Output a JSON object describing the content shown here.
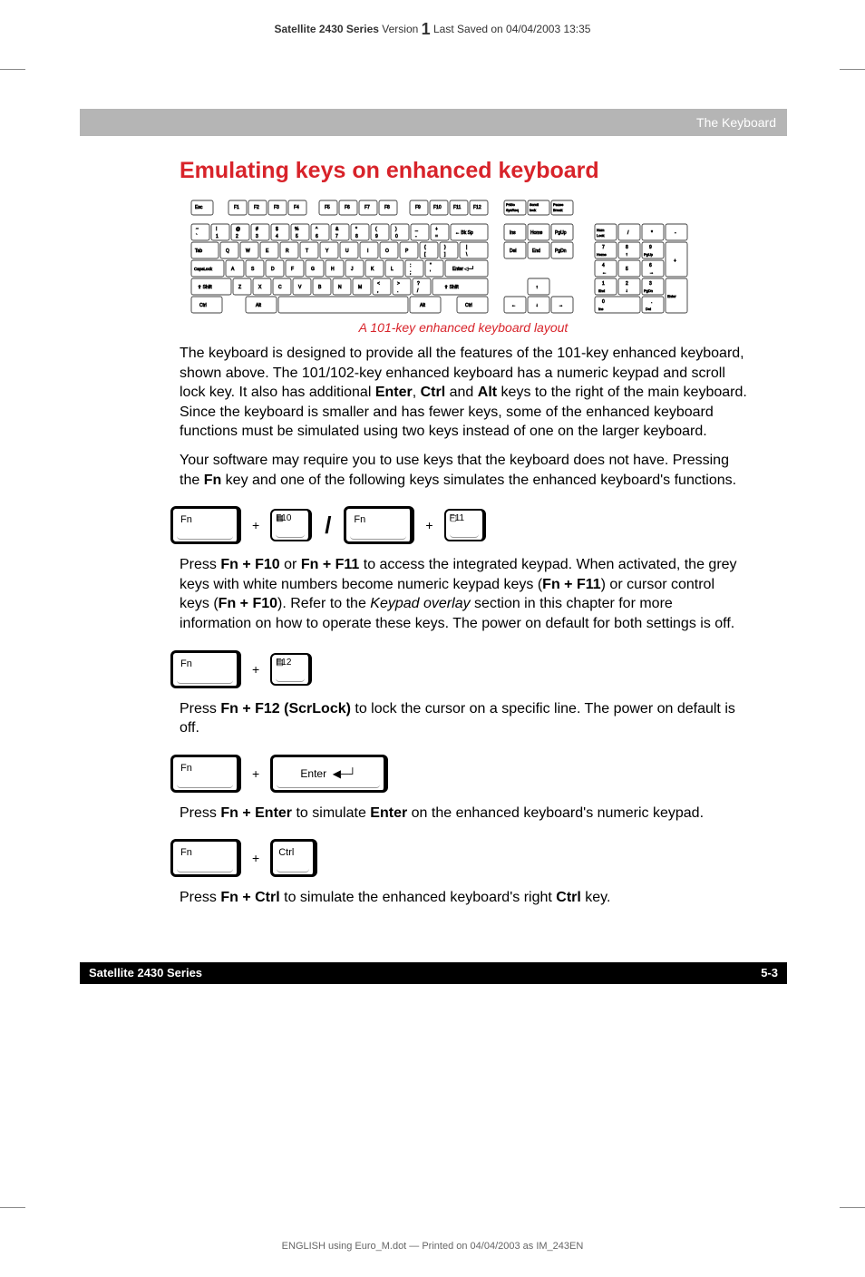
{
  "meta": {
    "product": "Satellite 2430 Series",
    "version_label": "Version",
    "version_num": "1",
    "saved": "Last Saved on 04/04/2003 13:35",
    "footer_print": "ENGLISH using Euro_M.dot — Printed on 04/04/2003 as IM_243EN"
  },
  "header": {
    "section": "The Keyboard"
  },
  "title": "Emulating keys on enhanced keyboard",
  "caption": "A 101-key enhanced keyboard layout",
  "paragraphs": {
    "p1_a": "The keyboard is designed to provide all the features of the 101-key enhanced keyboard, shown above. The 101/102-key enhanced keyboard has a numeric keypad and scroll lock key. It also has additional ",
    "p1_b": "Enter",
    "p1_c": ", ",
    "p1_d": "Ctrl",
    "p1_e": " and ",
    "p1_f": "Alt",
    "p1_g": " keys to the right of the main keyboard. Since the keyboard is smaller and has fewer keys, some of the enhanced keyboard functions must be simulated using two keys instead of one on the larger keyboard.",
    "p2_a": "Your software may require you to use keys that the keyboard does not have. Pressing the ",
    "p2_b": "Fn",
    "p2_c": " key and one of the following keys simulates the enhanced keyboard's functions.",
    "p3_a": "Press ",
    "p3_b": "Fn + F10",
    "p3_c": " or ",
    "p3_d": "Fn + F11",
    "p3_e": " to access the integrated keypad. When activated, the grey keys with white numbers become numeric keypad keys (",
    "p3_f": "Fn + F11",
    "p3_g": ") or cursor control keys (",
    "p3_h": "Fn + F10",
    "p3_i": "). Refer to the ",
    "p3_j": "Keypad overlay",
    "p3_k": " section in this chapter for more information on how to operate these keys. The power on default for both settings is off.",
    "p4_a": "Press ",
    "p4_b": "Fn + F12 (ScrLock)",
    "p4_c": " to lock the cursor on a specific line. The power on default is off.",
    "p5_a": "Press ",
    "p5_b": "Fn + Enter",
    "p5_c": " to simulate ",
    "p5_d": "Enter",
    "p5_e": " on the enhanced keyboard's numeric keypad.",
    "p6_a": "Press ",
    "p6_b": "Fn + Ctrl",
    "p6_c": " to simulate the enhanced keyboard's right ",
    "p6_d": "Ctrl",
    "p6_e": " key."
  },
  "keys": {
    "fn": "Fn",
    "f10": "F10",
    "f11": "F11",
    "f12": "F12",
    "enter": "Enter",
    "ctrl": "Ctrl",
    "plus": "+",
    "arrow": "◀─┘"
  },
  "keyboard_layout": {
    "row_func": [
      "Esc",
      "F1",
      "F2",
      "F3",
      "F4",
      "F5",
      "F6",
      "F7",
      "F8",
      "F9",
      "F10",
      "F11",
      "F12"
    ],
    "row_sys": [
      "PrtSc SysReq",
      "Scroll lock",
      "Pause Break"
    ],
    "row1_main": [
      "~ `",
      "! 1",
      "@ 2",
      "# 3",
      "$ 4",
      "% 5",
      "^ 6",
      "& 7",
      "* 8",
      "( 9",
      ") 0",
      "_ -",
      "+ =",
      "← Bk Sp"
    ],
    "row1_nav": [
      "Ins",
      "Home",
      "PgUp"
    ],
    "row2_main": [
      "Tab",
      "Q",
      "W",
      "E",
      "R",
      "T",
      "Y",
      "U",
      "I",
      "O",
      "P",
      "{ [",
      "} ]",
      "| \\"
    ],
    "row2_nav": [
      "Del",
      "End",
      "PgDn"
    ],
    "row3_main": [
      "CapsLock",
      "A",
      "S",
      "D",
      "F",
      "G",
      "H",
      "J",
      "K",
      "L",
      ": ;",
      "\" '",
      "Enter ◀─┘"
    ],
    "row4_main": [
      "⇧ Shift",
      "Z",
      "X",
      "C",
      "V",
      "B",
      "N",
      "M",
      "< ,",
      "> .",
      "? /",
      "⇧ Shift"
    ],
    "row4_nav": [
      "↑"
    ],
    "row5_main": [
      "Ctrl",
      "Alt",
      "",
      "Alt",
      "Ctrl"
    ],
    "row5_nav": [
      "←",
      "↓",
      "→"
    ],
    "numpad": {
      "r1": [
        "Num Lock",
        "/",
        "*",
        "-"
      ],
      "r2": [
        "7 Home",
        "8 ↑",
        "9 PgUp",
        "+"
      ],
      "r3": [
        "4 ←",
        "5",
        "6 →"
      ],
      "r4": [
        "1 End",
        "2 ↓",
        "3 PgDn",
        "Enter"
      ],
      "r5": [
        "0 Ins",
        ". Del"
      ]
    }
  },
  "footer": {
    "left": "Satellite 2430 Series",
    "right": "5-3"
  }
}
